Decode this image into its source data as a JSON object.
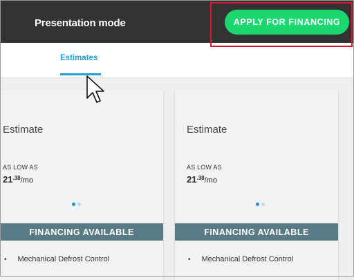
{
  "header": {
    "title": "Presentation mode",
    "apply_button_label": "APPLY FOR FINANCING"
  },
  "tabs": [
    {
      "label": "Estimates",
      "active": true
    }
  ],
  "cards": [
    {
      "title": "Estimate",
      "low_label": "AS LOW AS",
      "price_dollars": "21",
      "price_cents": ".38",
      "price_period": "/mo",
      "carousel_dots": 2,
      "carousel_active_index": 0,
      "financing_banner": "FINANCING AVAILABLE",
      "features": [
        "Mechanical Defrost Control"
      ]
    },
    {
      "title": "Estimate",
      "low_label": "AS LOW AS",
      "price_dollars": "21",
      "price_cents": ".38",
      "price_period": "/mo",
      "carousel_dots": 2,
      "carousel_active_index": 0,
      "financing_banner": "FINANCING AVAILABLE",
      "features": [
        "Mechanical Defrost Control"
      ]
    }
  ],
  "colors": {
    "header_bg": "#333333",
    "apply_button_bg": "#1bd86e",
    "highlight_border": "#d9182d",
    "tab_active": "#1aa0d8",
    "financing_banner_bg": "#587b86",
    "dot_active": "#2b8fd6",
    "dot_inactive": "#b9d9f3"
  },
  "icons": {
    "cursor": "arrow-pointer-icon",
    "bullet": "bullet-icon"
  }
}
